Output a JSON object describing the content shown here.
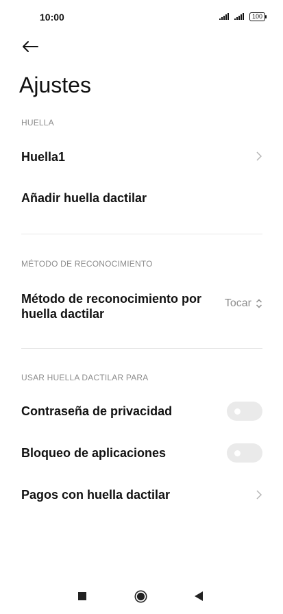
{
  "status_bar": {
    "time": "10:00",
    "battery": "100",
    "icons": [
      "signal-icon",
      "signal-icon",
      "battery-icon"
    ]
  },
  "header": {
    "back_icon": "arrow-left-icon",
    "title": "Ajustes"
  },
  "sections": [
    {
      "header": "HUELLA",
      "items": [
        {
          "label": "Huella1",
          "control": "chevron-right-icon"
        },
        {
          "label": "Añadir huella dactilar"
        }
      ]
    },
    {
      "header": "MÉTODO DE RECONOCIMIENTO",
      "items": [
        {
          "label_line1": "Método de reconocimiento por",
          "label_line2": "huella dactilar",
          "value": "Tocar",
          "control": "up-down-chevron-icon"
        }
      ]
    },
    {
      "header": "USAR HUELLA DACTILAR PARA",
      "items": [
        {
          "label": "Contraseña de privacidad",
          "control": "toggle",
          "enabled": false
        },
        {
          "label": "Bloqueo de aplicaciones",
          "control": "toggle",
          "enabled": false
        },
        {
          "label": "Pagos con huella dactilar",
          "control": "chevron-right-icon"
        }
      ]
    }
  ],
  "navigation_bar": {
    "icons": [
      "recents-square-icon",
      "home-circle-icon",
      "back-triangle-icon"
    ]
  },
  "colors": {
    "text": "#111111",
    "secondary": "#8c8c8c",
    "divider": "#e6e6e6",
    "toggle_off": "#eaeaea"
  }
}
